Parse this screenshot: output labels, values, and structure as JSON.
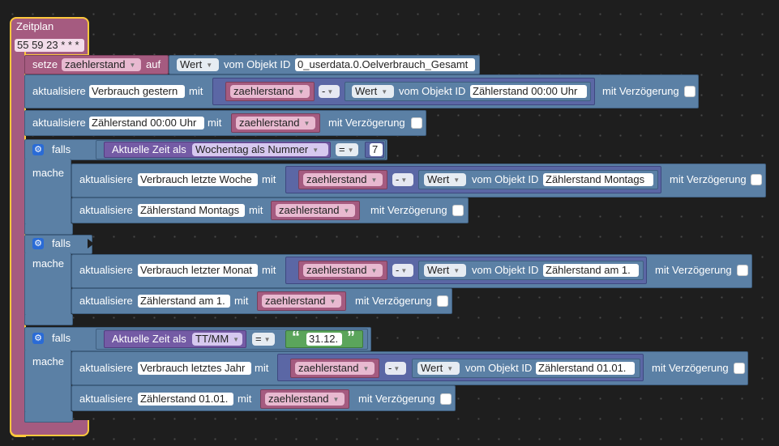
{
  "schedule": {
    "title": "Zeitplan",
    "cron": "55 59 23 * * *"
  },
  "setBlock": {
    "prefix": "setze",
    "variable": "zaehlerstand",
    "infix": "auf",
    "value": "Wert",
    "objectLabel": "vom Objekt ID",
    "objectId": "0_userdata.0.Oelverbrauch_Gesamt"
  },
  "labels": {
    "update": "aktualisiere",
    "with": "mit",
    "delay": "mit Verzögerung",
    "if": "falls",
    "do": "mache",
    "minus": "-",
    "value": "Wert",
    "fromObject": "vom Objekt ID",
    "variable": "zaehlerstand",
    "currentTimeAs": "Aktuelle Zeit als",
    "equals": "=",
    "quoteOpen": "“",
    "quoteClose": "”"
  },
  "updates": {
    "yesterday": {
      "target": "Verbrauch gestern",
      "sourceObject": "Zählerstand 00:00 Uhr"
    },
    "midnight": {
      "target": "Zählerstand 00:00 Uhr"
    },
    "week": {
      "target": "Verbrauch letzte Woche",
      "sourceObject": "Zählerstand Montags"
    },
    "monday": {
      "target": "Zählerstand Montags"
    },
    "month": {
      "target": "Verbrauch letzter Monat",
      "sourceObject": "Zählerstand am 1."
    },
    "first": {
      "target": "Zählerstand am 1."
    },
    "year": {
      "target": "Verbrauch letztes Jahr",
      "sourceObject": "Zählerstand 01.01."
    },
    "newyear": {
      "target": "Zählerstand 01.01."
    }
  },
  "conditions": {
    "weekday": {
      "format": "Wochentag als Nummer",
      "number": "7"
    },
    "date": {
      "format": "TT/MM",
      "text": "31.12."
    }
  },
  "colors": {
    "schedule": "#a55b80",
    "variables": "#a55b80",
    "system": "#5b80a5",
    "math": "#5b67a5",
    "logic": "#5b80a5",
    "time": "#745ba5",
    "text": "#5ba55b",
    "selected": "#fdc83c"
  }
}
